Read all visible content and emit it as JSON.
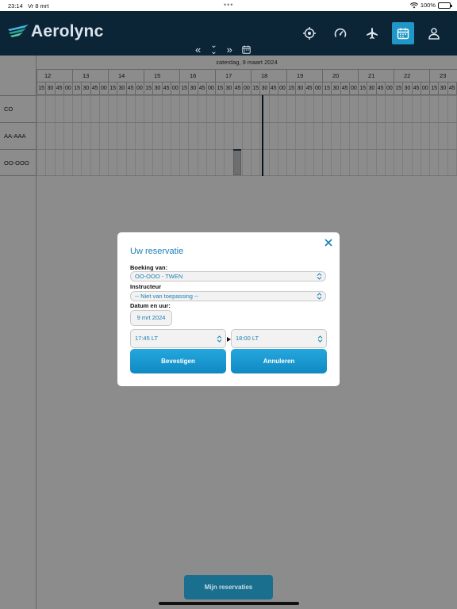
{
  "status_bar": {
    "time": "23:14",
    "date": "Vr 8 mrt",
    "battery": "100%",
    "dots": "•••"
  },
  "header": {
    "app_name": "Aerolync",
    "nav": {
      "prev": "«",
      "today": "⌄",
      "next": "»"
    },
    "active_tab": "calendar"
  },
  "schedule": {
    "date_label": "zaterdag, 9 maart 2024",
    "hours": [
      "12",
      "13",
      "14",
      "15",
      "16",
      "17",
      "18",
      "19",
      "20",
      "21",
      "22",
      "23"
    ],
    "minutes": [
      "15",
      "30",
      "45",
      "00"
    ],
    "aircraft": [
      "CO",
      "AA-AAA",
      "OO-OOO"
    ]
  },
  "modal": {
    "title": "Uw reservatie",
    "booking_label": "Boeking van:",
    "booking_value": "OO-OOO - TWEN",
    "instructor_label": "Instructeur",
    "instructor_value": "-- Niet van toepassing --",
    "date_label": "Datum en uur:",
    "date_value": "9 mrt 2024",
    "start_time": "17:45 LT",
    "end_time": "18:00 LT",
    "confirm_label": "Bevestigen",
    "cancel_label": "Annuleren"
  },
  "footer": {
    "my_reservations": "Mijn reservaties"
  },
  "colors": {
    "header": "#0b2436",
    "accent": "#1f97c9",
    "button": "#1189c3"
  }
}
